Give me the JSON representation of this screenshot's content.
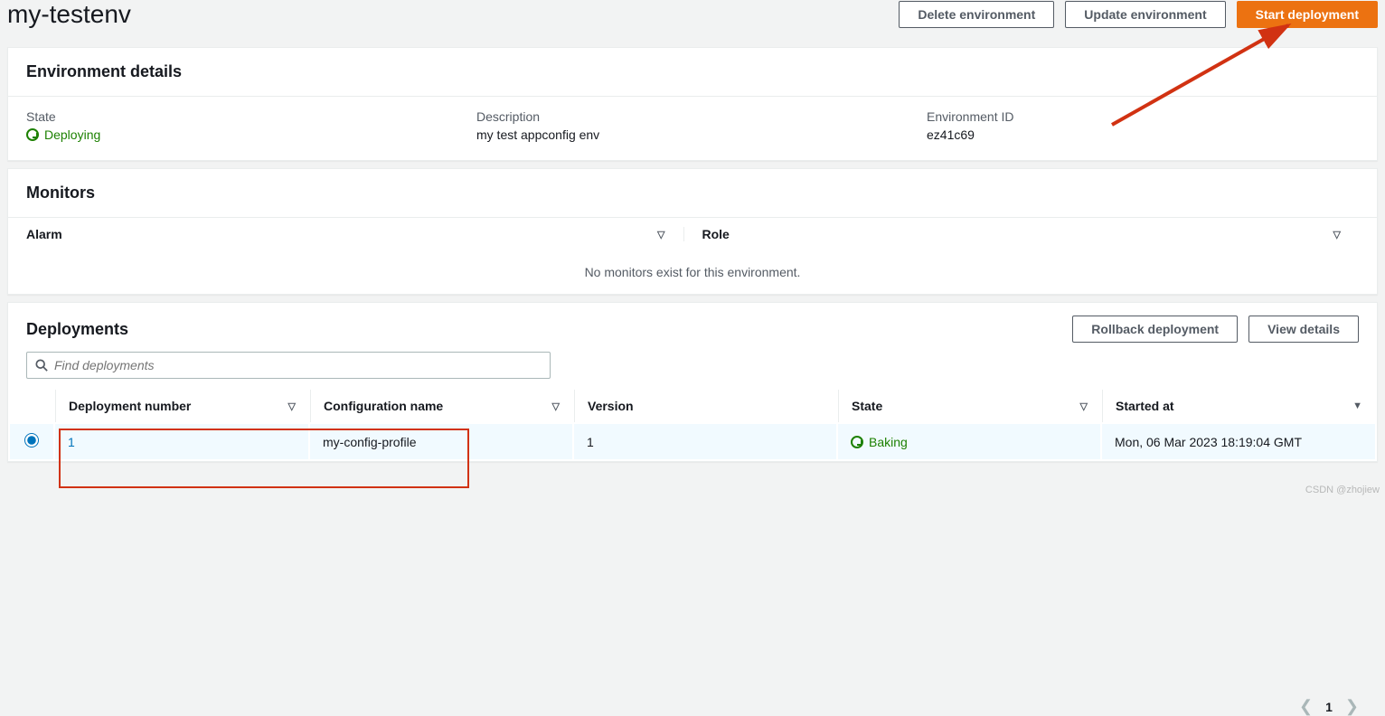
{
  "header": {
    "title": "my-testenv",
    "delete_btn": "Delete environment",
    "update_btn": "Update environment",
    "start_btn": "Start deployment"
  },
  "details": {
    "panel_title": "Environment details",
    "state_label": "State",
    "state_value": "Deploying",
    "desc_label": "Description",
    "desc_value": "my test appconfig env",
    "envid_label": "Environment ID",
    "envid_value": "ez41c69"
  },
  "monitors": {
    "panel_title": "Monitors",
    "col_alarm": "Alarm",
    "col_role": "Role",
    "empty": "No monitors exist for this environment."
  },
  "deployments": {
    "panel_title": "Deployments",
    "rollback_btn": "Rollback deployment",
    "view_btn": "View details",
    "search_placeholder": "Find deployments",
    "page_num": "1",
    "cols": {
      "number": "Deployment number",
      "config": "Configuration name",
      "version": "Version",
      "state": "State",
      "started": "Started at"
    },
    "row": {
      "number": "1",
      "config": "my-config-profile",
      "version": "1",
      "state": "Baking",
      "started": "Mon, 06 Mar 2023 18:19:04 GMT"
    }
  },
  "watermark": "CSDN @zhojiew"
}
